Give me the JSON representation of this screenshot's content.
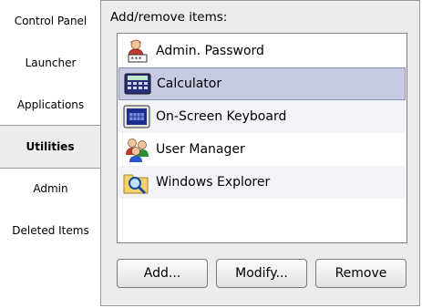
{
  "tabs": [
    "Control Panel",
    "Launcher",
    "Applications",
    "Utilities",
    "Admin",
    "Deleted Items"
  ],
  "active_tab": "Utilities",
  "panel": {
    "label": "Add/remove items:",
    "items": [
      {
        "label": "Admin. Password",
        "icon": "admin-password-icon"
      },
      {
        "label": "Calculator",
        "icon": "calculator-icon",
        "selected": true
      },
      {
        "label": "On-Screen Keyboard",
        "icon": "keyboard-icon"
      },
      {
        "label": "User Manager",
        "icon": "users-icon"
      },
      {
        "label": "Windows Explorer",
        "icon": "folder-search-icon"
      }
    ]
  },
  "buttons": {
    "add": "Add...",
    "modify": "Modify...",
    "remove": "Remove"
  }
}
